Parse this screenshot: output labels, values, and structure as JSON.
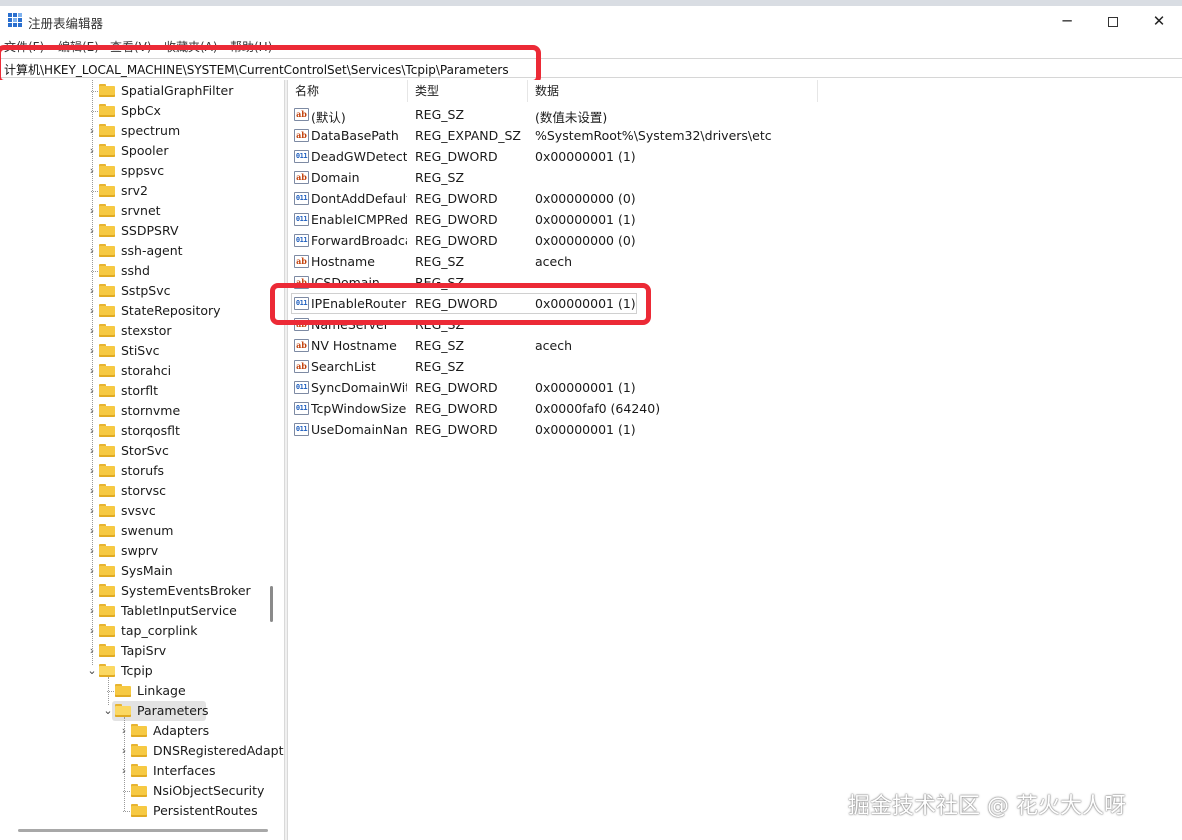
{
  "window": {
    "title": "注册表编辑器",
    "controls": {
      "minimize": "─",
      "close": "✕"
    }
  },
  "menu": [
    "文件(F)",
    "编辑(E)",
    "查看(V)",
    "收藏夹(A)",
    "帮助(H)"
  ],
  "address": "计算机\\HKEY_LOCAL_MACHINE\\SYSTEM\\CurrentControlSet\\Services\\Tcpip\\Parameters",
  "tree": [
    {
      "label": "SpatialGraphFilter",
      "level": 0,
      "expand": "none"
    },
    {
      "label": "SpbCx",
      "level": 0,
      "expand": "none"
    },
    {
      "label": "spectrum",
      "level": 0,
      "expand": "closed"
    },
    {
      "label": "Spooler",
      "level": 0,
      "expand": "closed"
    },
    {
      "label": "sppsvc",
      "level": 0,
      "expand": "closed"
    },
    {
      "label": "srv2",
      "level": 0,
      "expand": "none"
    },
    {
      "label": "srvnet",
      "level": 0,
      "expand": "closed"
    },
    {
      "label": "SSDPSRV",
      "level": 0,
      "expand": "closed"
    },
    {
      "label": "ssh-agent",
      "level": 0,
      "expand": "closed"
    },
    {
      "label": "sshd",
      "level": 0,
      "expand": "none"
    },
    {
      "label": "SstpSvc",
      "level": 0,
      "expand": "closed"
    },
    {
      "label": "StateRepository",
      "level": 0,
      "expand": "closed"
    },
    {
      "label": "stexstor",
      "level": 0,
      "expand": "closed"
    },
    {
      "label": "StiSvc",
      "level": 0,
      "expand": "closed"
    },
    {
      "label": "storahci",
      "level": 0,
      "expand": "closed"
    },
    {
      "label": "storflt",
      "level": 0,
      "expand": "closed"
    },
    {
      "label": "stornvme",
      "level": 0,
      "expand": "closed"
    },
    {
      "label": "storqosflt",
      "level": 0,
      "expand": "closed"
    },
    {
      "label": "StorSvc",
      "level": 0,
      "expand": "closed"
    },
    {
      "label": "storufs",
      "level": 0,
      "expand": "closed"
    },
    {
      "label": "storvsc",
      "level": 0,
      "expand": "closed"
    },
    {
      "label": "svsvc",
      "level": 0,
      "expand": "closed"
    },
    {
      "label": "swenum",
      "level": 0,
      "expand": "closed"
    },
    {
      "label": "swprv",
      "level": 0,
      "expand": "closed"
    },
    {
      "label": "SysMain",
      "level": 0,
      "expand": "closed"
    },
    {
      "label": "SystemEventsBroker",
      "level": 0,
      "expand": "closed"
    },
    {
      "label": "TabletInputService",
      "level": 0,
      "expand": "closed"
    },
    {
      "label": "tap_corplink",
      "level": 0,
      "expand": "closed"
    },
    {
      "label": "TapiSrv",
      "level": 0,
      "expand": "closed"
    },
    {
      "label": "Tcpip",
      "level": 0,
      "expand": "open"
    },
    {
      "label": "Linkage",
      "level": 1,
      "expand": "none"
    },
    {
      "label": "Parameters",
      "level": 1,
      "expand": "open",
      "selected": true
    },
    {
      "label": "Adapters",
      "level": 2,
      "expand": "closed"
    },
    {
      "label": "DNSRegisteredAdapters",
      "level": 2,
      "expand": "closed"
    },
    {
      "label": "Interfaces",
      "level": 2,
      "expand": "closed"
    },
    {
      "label": "NsiObjectSecurity",
      "level": 2,
      "expand": "none"
    },
    {
      "label": "PersistentRoutes",
      "level": 2,
      "expand": "none"
    }
  ],
  "columns": {
    "name": "名称",
    "type": "类型",
    "data": "数据"
  },
  "values": [
    {
      "icon": "sz",
      "name": "(默认)",
      "type": "REG_SZ",
      "data": "(数值未设置)"
    },
    {
      "icon": "sz",
      "name": "DataBasePath",
      "type": "REG_EXPAND_SZ",
      "data": "%SystemRoot%\\System32\\drivers\\etc"
    },
    {
      "icon": "dw",
      "name": "DeadGWDetectDefault",
      "type": "REG_DWORD",
      "data": "0x00000001 (1)"
    },
    {
      "icon": "sz",
      "name": "Domain",
      "type": "REG_SZ",
      "data": ""
    },
    {
      "icon": "dw",
      "name": "DontAddDefaultGateway",
      "type": "REG_DWORD",
      "data": "0x00000000 (0)"
    },
    {
      "icon": "dw",
      "name": "EnableICMPRedirect",
      "type": "REG_DWORD",
      "data": "0x00000001 (1)"
    },
    {
      "icon": "dw",
      "name": "ForwardBroadcasts",
      "type": "REG_DWORD",
      "data": "0x00000000 (0)"
    },
    {
      "icon": "sz",
      "name": "Hostname",
      "type": "REG_SZ",
      "data": "acech"
    },
    {
      "icon": "sz",
      "name": "ICSDomain",
      "type": "REG_SZ",
      "data": ""
    },
    {
      "icon": "dw",
      "name": "IPEnableRouter",
      "type": "REG_DWORD",
      "data": "0x00000001 (1)",
      "focused": true
    },
    {
      "icon": "sz",
      "name": "NameServer",
      "type": "REG_SZ",
      "data": ""
    },
    {
      "icon": "sz",
      "name": "NV Hostname",
      "type": "REG_SZ",
      "data": "acech"
    },
    {
      "icon": "sz",
      "name": "SearchList",
      "type": "REG_SZ",
      "data": ""
    },
    {
      "icon": "dw",
      "name": "SyncDomainWithMembership",
      "type": "REG_DWORD",
      "data": "0x00000001 (1)"
    },
    {
      "icon": "dw",
      "name": "TcpWindowSize",
      "type": "REG_DWORD",
      "data": "0x0000faf0 (64240)"
    },
    {
      "icon": "dw",
      "name": "UseDomainNameDevolution",
      "type": "REG_DWORD",
      "data": "0x00000001 (1)"
    }
  ],
  "icons": {
    "sz": "ab",
    "dw": "011",
    "closed": "›",
    "open": "⌄"
  },
  "colors": {
    "highlight": "#ec2a36",
    "folder": "#f6c943"
  },
  "watermark": "掘金技术社区 @ 花火大人呀"
}
